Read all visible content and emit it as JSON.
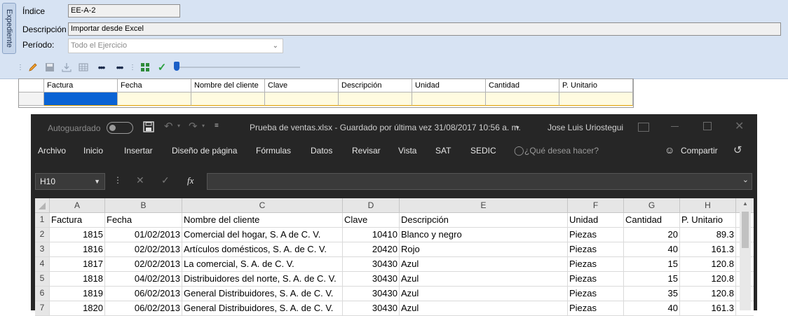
{
  "form": {
    "side_tab": "Expediente",
    "indice_label": "Índice",
    "indice_value": "EE-A-2",
    "descripcion_label": "Descripción",
    "descripcion_value": "Importar desde Excel",
    "periodo_label": "Período:",
    "periodo_value": "Todo el Ejercicio"
  },
  "toolbar": {
    "icons": [
      "pencil-icon",
      "save-icon",
      "download-icon",
      "table-icon",
      "dots-icon",
      "dots-icon",
      "grid-icon",
      "check-icon"
    ],
    "slider_position": 0
  },
  "grid": {
    "columns": [
      "Factura",
      "Fecha",
      "Nombre del cliente",
      "Clave",
      "Descripción",
      "Unidad",
      "Cantidad",
      "P. Unitario"
    ]
  },
  "excel": {
    "autosave_label": "Autoguardado",
    "title": "Prueba de ventas.xlsx  -  Guardado por última vez 31/08/2017 10:56 a. m.",
    "user": "Jose Luis Uriostegui",
    "menu": [
      "Archivo",
      "Inicio",
      "Insertar",
      "Diseño de página",
      "Fórmulas",
      "Datos",
      "Revisar",
      "Vista",
      "SAT",
      "SEDIC"
    ],
    "search_hint": "¿Qué desea hacer?",
    "share_label": "Compartir",
    "namebox": "H10",
    "fx": "fx",
    "col_letters": [
      "A",
      "B",
      "C",
      "D",
      "E",
      "F",
      "G",
      "H"
    ],
    "rows": [
      {
        "n": "1",
        "cells": [
          "Factura",
          "Fecha",
          "Nombre del cliente",
          "Clave",
          "Descripción",
          "Unidad",
          "Cantidad",
          "P. Unitario"
        ]
      },
      {
        "n": "2",
        "cells": [
          "1815",
          "01/02/2013",
          "Comercial del hogar, S. A de C. V.",
          "10410",
          "Blanco y negro",
          "Piezas",
          "20",
          "89.3"
        ]
      },
      {
        "n": "3",
        "cells": [
          "1816",
          "02/02/2013",
          "Artículos domésticos, S. A. de C. V.",
          "20420",
          "Rojo",
          "Piezas",
          "40",
          "161.3"
        ]
      },
      {
        "n": "4",
        "cells": [
          "1817",
          "02/02/2013",
          "La comercial, S. A. de C. V.",
          "30430",
          "Azul",
          "Piezas",
          "15",
          "120.8"
        ]
      },
      {
        "n": "5",
        "cells": [
          "1818",
          "04/02/2013",
          "Distribuidores del norte, S. A. de C. V.",
          "30430",
          "Azul",
          "Piezas",
          "15",
          "120.8"
        ]
      },
      {
        "n": "6",
        "cells": [
          "1819",
          "06/02/2013",
          "General Distribuidores, S. A. de C. V.",
          "30430",
          "Azul",
          "Piezas",
          "35",
          "120.8"
        ]
      },
      {
        "n": "7",
        "cells": [
          "1820",
          "06/02/2013",
          "General Distribuidores, S. A. de C. V.",
          "30430",
          "Azul",
          "Piezas",
          "40",
          "161.3"
        ]
      }
    ]
  }
}
